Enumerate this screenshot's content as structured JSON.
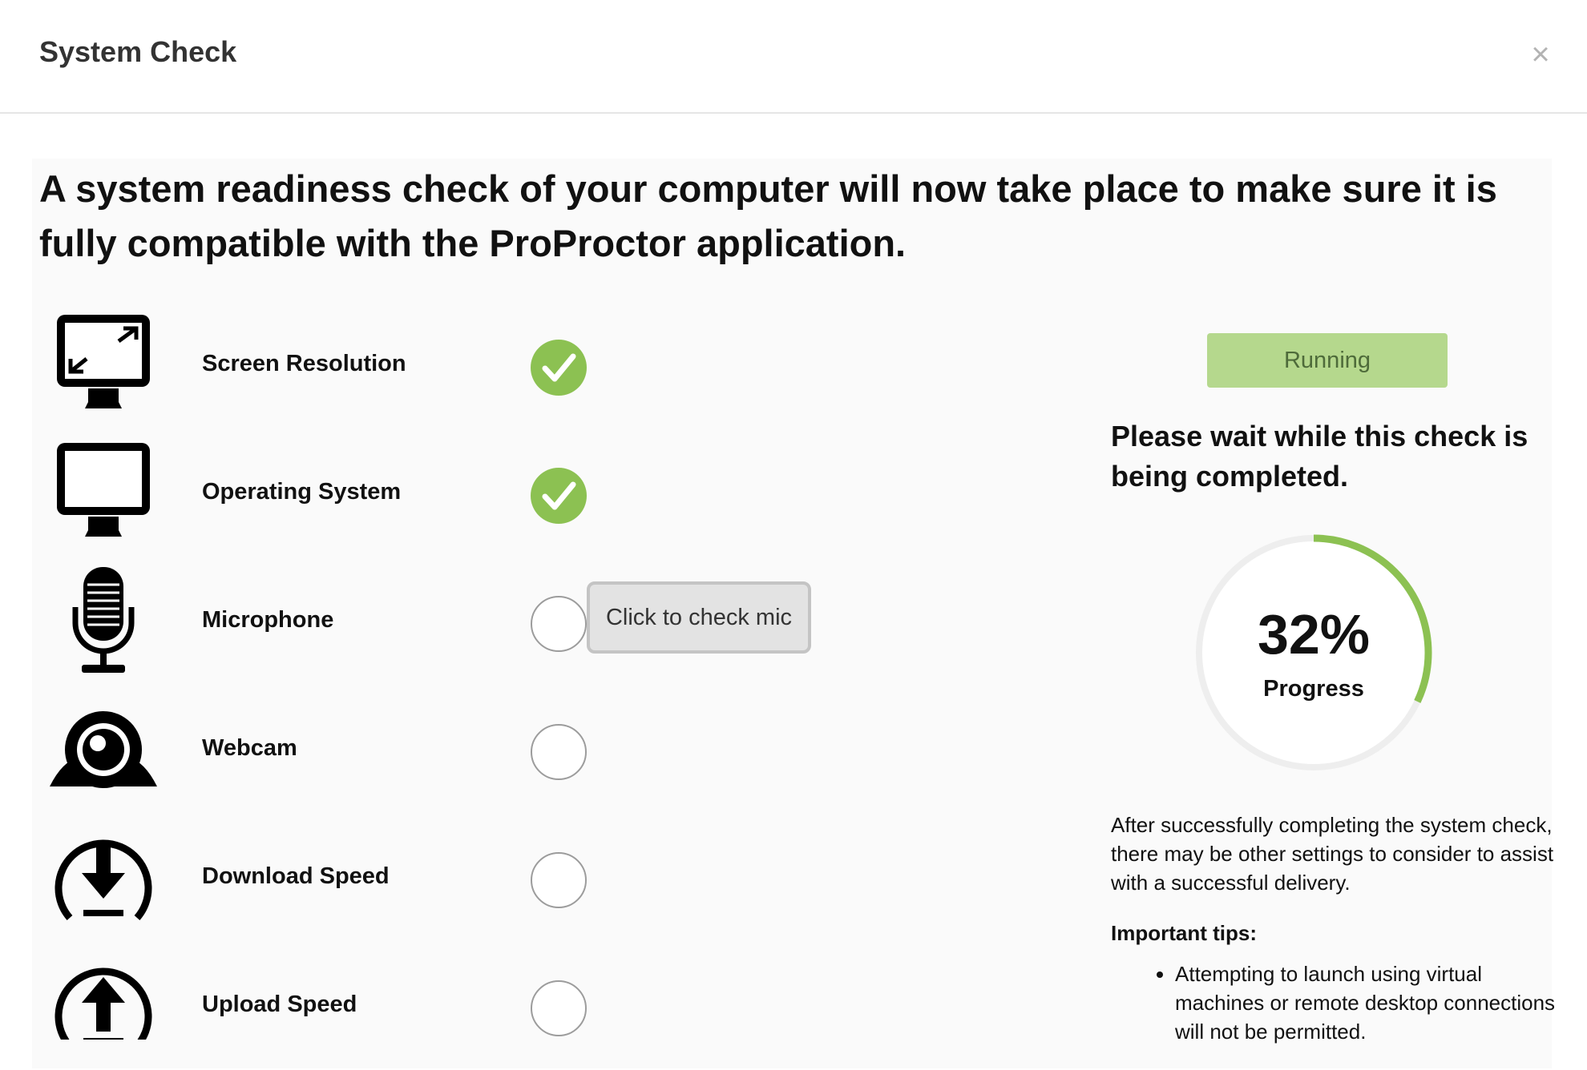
{
  "header": {
    "title": "System Check",
    "close_label": "×"
  },
  "intro": "A system readiness check of your computer will now take place to make sure it is fully compatible with the ProProctor application.",
  "checks": [
    {
      "label": "Screen Resolution",
      "icon": "screen-resolution-icon",
      "status": "passed"
    },
    {
      "label": "Operating System",
      "icon": "monitor-icon",
      "status": "passed"
    },
    {
      "label": "Microphone",
      "icon": "microphone-icon",
      "status": "pending",
      "action_label": "Click to check mic"
    },
    {
      "label": "Webcam",
      "icon": "webcam-icon",
      "status": "pending"
    },
    {
      "label": "Download Speed",
      "icon": "download-icon",
      "status": "pending"
    },
    {
      "label": "Upload Speed",
      "icon": "upload-icon",
      "status": "pending"
    }
  ],
  "status_panel": {
    "button_label": "Running",
    "wait_text": "Please wait while this check is being completed.",
    "progress_percent": 32,
    "progress_text": "32%",
    "progress_label": "Progress",
    "after_text": "After successfully completing the system check, there may be other settings to consider to assist with a successful delivery.",
    "tips_title": "Important tips:",
    "tips": [
      "Attempting to launch using virtual machines or remote desktop connections will not be permitted."
    ]
  },
  "colors": {
    "success": "#8cc152",
    "running_bg": "#b5d88d",
    "running_text": "#4e6b3a",
    "progress_track": "#eeeeee"
  }
}
